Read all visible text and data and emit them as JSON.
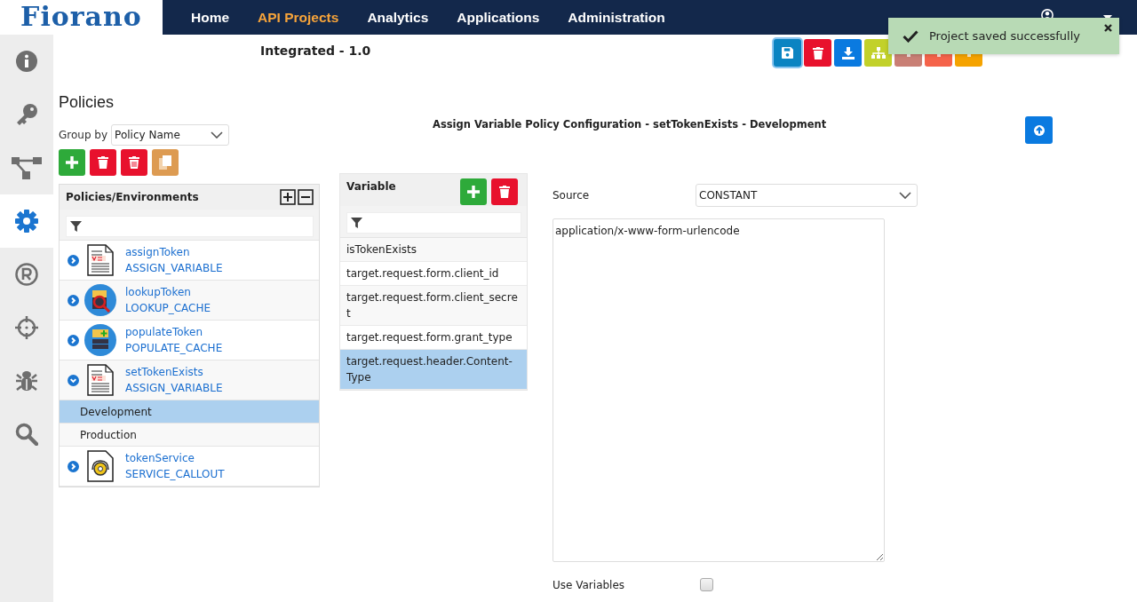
{
  "logo": "Fiorano",
  "nav": [
    {
      "label": "Home",
      "selected": false
    },
    {
      "label": "API Projects",
      "selected": true
    },
    {
      "label": "Analytics",
      "selected": false
    },
    {
      "label": "Applications",
      "selected": false
    },
    {
      "label": "Administration",
      "selected": false
    }
  ],
  "sidebar": [
    {
      "kind": "info",
      "selected": false
    },
    {
      "kind": "key",
      "selected": false
    },
    {
      "kind": "flow",
      "selected": false
    },
    {
      "kind": "gear",
      "selected": true
    },
    {
      "kind": "registered",
      "selected": false
    },
    {
      "kind": "crosshairs",
      "selected": false
    },
    {
      "kind": "bug",
      "selected": false
    },
    {
      "kind": "search",
      "selected": false
    }
  ],
  "project_title": "Integrated - 1.0",
  "toolbar": [
    {
      "kind": "save",
      "color": "#0b84c2",
      "focused": true
    },
    {
      "kind": "delete",
      "color": "#e8112d",
      "focused": false
    },
    {
      "kind": "download",
      "color": "#0a7ae0",
      "focused": false
    },
    {
      "kind": "hierarchy",
      "color": "#c2d12a",
      "focused": false
    },
    {
      "kind": "other",
      "color": "#c97f75",
      "focused": false
    },
    {
      "kind": "other",
      "color": "#f5634a",
      "focused": false
    },
    {
      "kind": "other",
      "color": "#f5a300",
      "focused": false
    }
  ],
  "toast": {
    "message": "Project saved successfully"
  },
  "policies": {
    "heading": "Policies",
    "group_by_label": "Group by",
    "group_by_value": "Policy Name",
    "buttons": [
      {
        "kind": "add",
        "color": "#2eaa3a"
      },
      {
        "kind": "delete",
        "color": "#e8112d"
      },
      {
        "kind": "delete-all",
        "color": "#e8112d"
      },
      {
        "kind": "copy",
        "color": "#dd9b52"
      }
    ],
    "tree_header": "Policies/Environments",
    "items": [
      {
        "name": "assignToken",
        "type": "ASSIGN_VARIABLE",
        "kind": "assign",
        "expanded": false
      },
      {
        "name": "lookupToken",
        "type": "LOOKUP_CACHE",
        "kind": "lookup",
        "expanded": false
      },
      {
        "name": "populateToken",
        "type": "POPULATE_CACHE",
        "kind": "populate",
        "expanded": false
      },
      {
        "name": "setTokenExists",
        "type": "ASSIGN_VARIABLE",
        "kind": "assign",
        "expanded": true,
        "children": [
          {
            "label": "Development",
            "selected": true
          },
          {
            "label": "Production",
            "selected": false
          }
        ]
      },
      {
        "name": "tokenService",
        "type": "SERVICE_CALLOUT",
        "kind": "callout",
        "expanded": false
      }
    ]
  },
  "config": {
    "title": "Assign Variable Policy Configuration - setTokenExists - Development",
    "variable_header": "Variable",
    "variables": [
      {
        "name": "isTokenExists",
        "selected": false
      },
      {
        "name": "target.request.form.client_id",
        "selected": false
      },
      {
        "name": "target.request.form.client_secret",
        "selected": false
      },
      {
        "name": "target.request.form.grant_type",
        "selected": false
      },
      {
        "name": "target.request.header.Content-Type",
        "selected": true
      }
    ],
    "source_label": "Source",
    "source_value": "CONSTANT",
    "value": "application/x-www-form-urlencode",
    "use_variables_label": "Use Variables",
    "use_variables": false
  }
}
